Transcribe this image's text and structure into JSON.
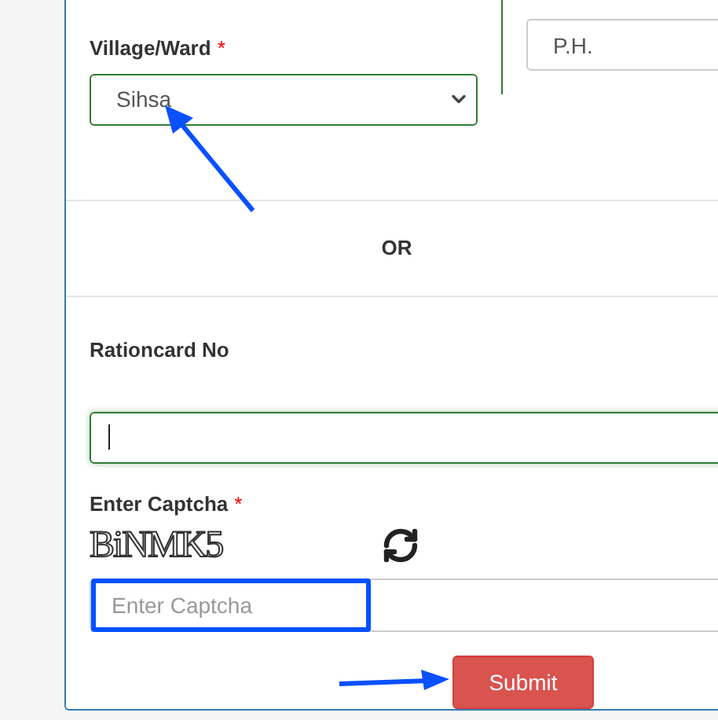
{
  "village_field": {
    "label": "Village/Ward",
    "required_mark": "*",
    "value": "Sihsa"
  },
  "ph_field": {
    "placeholder": "P.H."
  },
  "separator": {
    "text": "OR"
  },
  "rationcard_field": {
    "label": "Rationcard No",
    "focused": true
  },
  "captcha": {
    "label": "Enter Captcha",
    "required_mark": "*",
    "image_text": "BiNMK5",
    "placeholder": "Enter Captcha",
    "highlighted": true
  },
  "submit_button": {
    "label": "Submit"
  }
}
